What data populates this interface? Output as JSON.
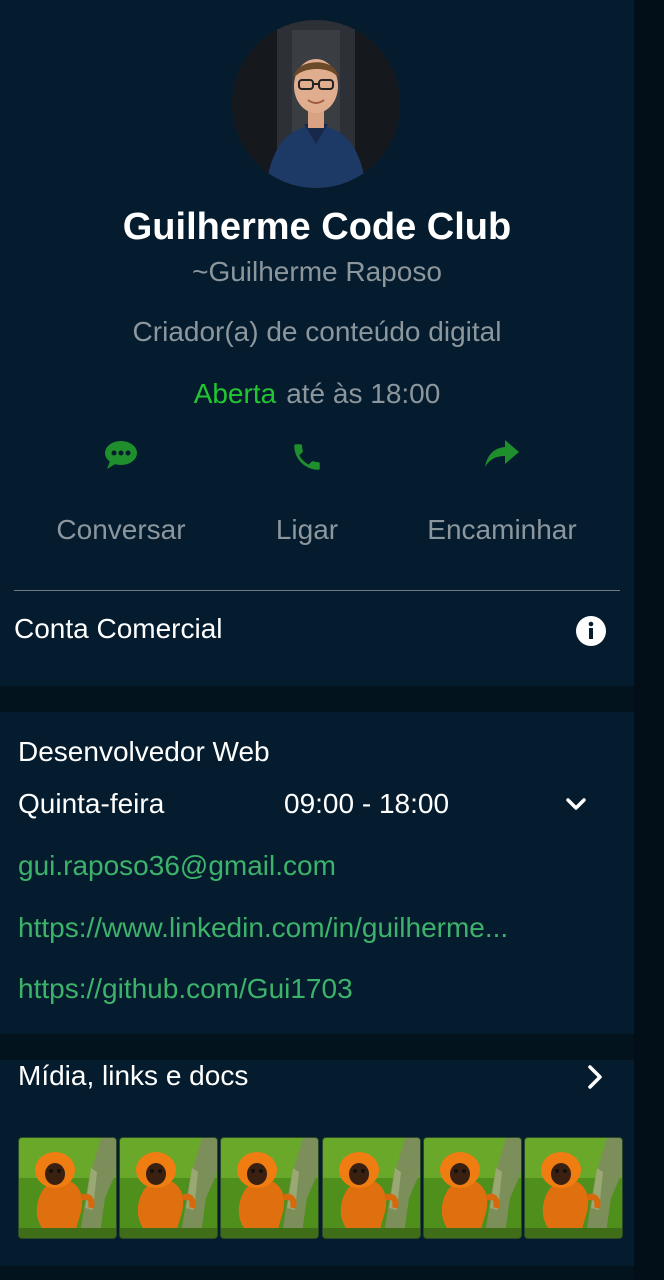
{
  "profile": {
    "name": "Guilherme Code Club",
    "push_name": "~Guilherme Raposo",
    "category": "Criador(a) de conteúdo digital",
    "status_open": "Aberta",
    "status_until": "até às 18:00"
  },
  "actions": [
    {
      "label": "Conversar",
      "icon": "chat-icon"
    },
    {
      "label": "Ligar",
      "icon": "phone-icon"
    },
    {
      "label": "Encaminhar",
      "icon": "share-icon"
    }
  ],
  "business_account": {
    "label": "Conta Comercial",
    "icon": "info-icon"
  },
  "details": {
    "description": "Desenvolvedor Web",
    "day": "Quinta-feira",
    "hours": "09:00 - 18:00",
    "email": "gui.raposo36@gmail.com",
    "linkedin": "https://www.linkedin.com/in/guilherme...",
    "github": "https://github.com/Gui1703"
  },
  "media": {
    "title": "Mídia, links e docs",
    "thumbnail_count": 6
  },
  "colors": {
    "background": "#03131e",
    "panel": "#051c2e",
    "accent_green": "#22c532",
    "icon_green": "#1f8f2d",
    "link_green": "#3db26a",
    "muted_text": "#8c969d"
  }
}
